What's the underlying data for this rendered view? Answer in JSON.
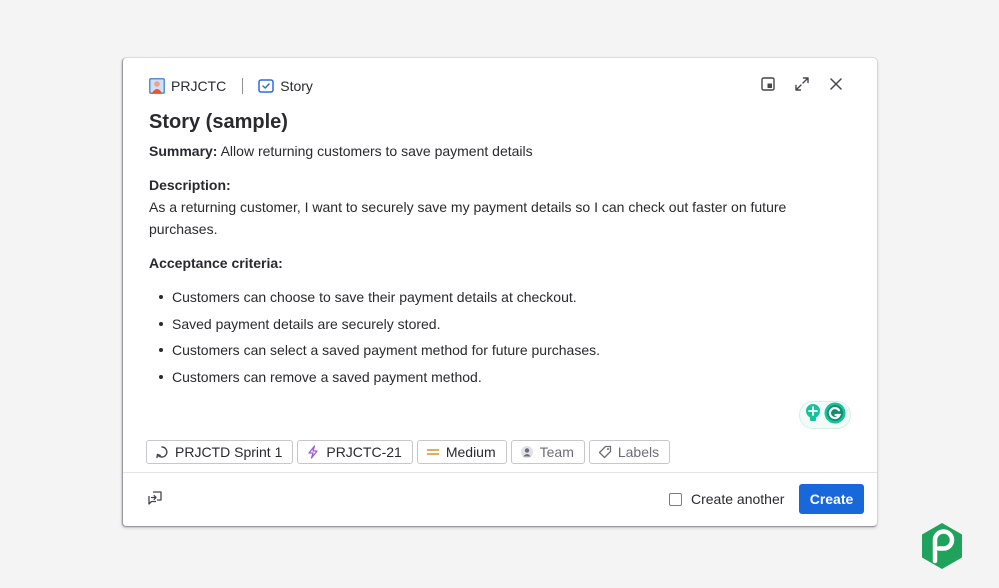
{
  "header": {
    "project_label": "PRJCTC",
    "issue_type_label": "Story"
  },
  "issue": {
    "title": "Story (sample)",
    "summary_label": "Summary:",
    "summary_text": "Allow returning customers to save payment details",
    "description_label": "Description:",
    "description_text": "As a returning customer, I want to securely save my payment details so I can check out faster on future purchases.",
    "acceptance_label": "Acceptance criteria:",
    "acceptance_items": [
      "Customers can choose to save their payment details at checkout.",
      "Saved payment details are securely stored.",
      "Customers can select a saved payment method for future purchases.",
      "Customers can remove a saved payment method."
    ]
  },
  "chips": {
    "sprint": "PRJCTD Sprint 1",
    "parent": "PRJCTC-21",
    "priority": "Medium",
    "team": "Team",
    "labels": "Labels"
  },
  "footer": {
    "create_another_label": "Create another",
    "create_button_label": "Create"
  },
  "colors": {
    "primary": "#1868db",
    "priority_medium": "#e2a13b",
    "story_icon": "#2d6cdf",
    "parent_icon": "#9f5bd6",
    "brand_green": "#1fa35c"
  },
  "icons": {
    "project": "project-avatar-icon",
    "issue_type": "story-icon",
    "minimize": "minimize-icon",
    "expand": "expand-icon",
    "close": "close-icon",
    "sprint": "sprint-icon",
    "parent": "lightning-icon",
    "priority": "priority-medium-icon",
    "team": "team-icon",
    "labels": "tag-icon",
    "feedback": "feedback-icon"
  }
}
